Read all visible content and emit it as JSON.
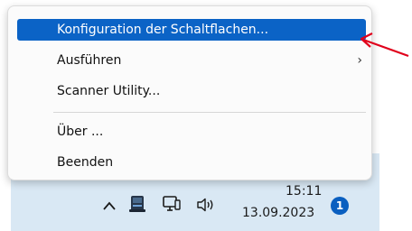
{
  "context_menu": {
    "items": [
      {
        "label": "Konfiguration der Schaltflachen..."
      },
      {
        "label": "Ausführen"
      },
      {
        "label": "Scanner Utility..."
      },
      {
        "label": "Über ..."
      },
      {
        "label": "Beenden"
      }
    ],
    "submenu_chevron": "›",
    "highlight_color": "#0b63c6"
  },
  "taskbar": {
    "time": "15:11",
    "date": "13.09.2023",
    "notification_count": "1",
    "icons": [
      "chevron-up-icon",
      "scanner-app-icon",
      "network-icon",
      "speaker-icon"
    ]
  },
  "annotation": {
    "arrow_color": "#e0001b"
  }
}
